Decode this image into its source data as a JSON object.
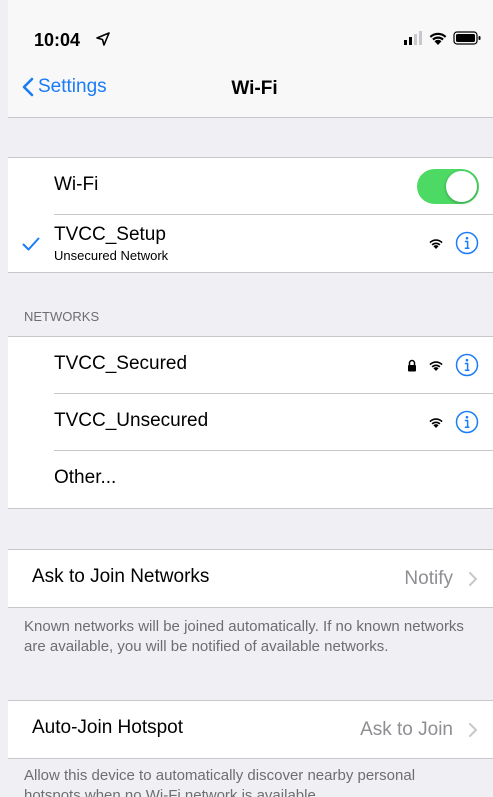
{
  "status_bar": {
    "time": "10:04"
  },
  "nav": {
    "back_label": "Settings",
    "title": "Wi-Fi"
  },
  "wifi": {
    "toggle_label": "Wi-Fi",
    "toggle_on": true,
    "connected_network": {
      "name": "TVCC_Setup",
      "status": "Unsecured Network"
    }
  },
  "networks": {
    "header": "NETWORKS",
    "items": [
      {
        "name": "TVCC_Secured",
        "locked": true
      },
      {
        "name": "TVCC_Unsecured",
        "locked": false
      }
    ],
    "other_label": "Other..."
  },
  "ask_to_join": {
    "label": "Ask to Join Networks",
    "value": "Notify",
    "footer": "Known networks will be joined automatically. If no known networks are available, you will be notified of available networks."
  },
  "auto_join_hotspot": {
    "label": "Auto-Join Hotspot",
    "value": "Ask to Join",
    "footer": "Allow this device to automatically discover nearby personal hotspots when no Wi-Fi network is available."
  },
  "colors": {
    "accent": "#1a7cf6",
    "toggle_on": "#4cd964",
    "background": "#efeff4",
    "secondary_text": "#8e8e93"
  },
  "icons": [
    "location-arrow-icon",
    "cellular-signal-icon",
    "wifi-status-icon",
    "battery-icon",
    "back-chevron-icon",
    "checkmark-icon",
    "wifi-signal-icon",
    "lock-icon",
    "info-icon",
    "chevron-right-icon"
  ]
}
